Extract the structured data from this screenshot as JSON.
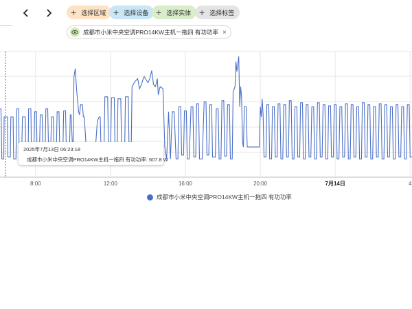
{
  "toolbar": {
    "prev_icon": "chevron-left-icon",
    "next_icon": "chevron-right-icon",
    "chips": [
      {
        "label": "选择区域",
        "color": "#fde2c4",
        "icon": "plus-icon"
      },
      {
        "label": "选择设备",
        "color": "#c9e6f7",
        "icon": "plus-icon"
      },
      {
        "label": "选择实体",
        "color": "#d9edc9",
        "icon": "plus-icon"
      },
      {
        "label": "选择标签",
        "color": "#e4e4e4",
        "icon": "plus-icon"
      }
    ]
  },
  "entity": {
    "label": "成都市小米中央空调PRO14KW主机一拖四 有功功率",
    "icon": "eye-icon",
    "close": "×"
  },
  "tooltip": {
    "time": "2025年7月13日 06:23:18",
    "series": "成都市小米中央空调PRO14KW主机一拖四 有功功率",
    "value": "607.8 W"
  },
  "chart_data": {
    "type": "line",
    "title": "",
    "xlabel": "",
    "ylabel": "",
    "x_ticks": [
      {
        "label": "8:00",
        "hour": 8,
        "bold": false
      },
      {
        "label": "12:00",
        "hour": 12,
        "bold": false
      },
      {
        "label": "16:00",
        "hour": 16,
        "bold": false
      },
      {
        "label": "20:00",
        "hour": 20,
        "bold": false
      },
      {
        "label": "7月14日",
        "hour": 24,
        "bold": true
      },
      {
        "label": "4",
        "hour": 28,
        "bold": false
      }
    ],
    "x_range_hours": [
      6.1,
      28.1
    ],
    "y_range": [
      0,
      1250
    ],
    "cursor_hour": 6.39,
    "line_color": "#4a6fc7",
    "series": [
      {
        "name": "成都市小米中央空调PRO14KW主机一拖四 有功功率",
        "color": "#4a6fc7",
        "points": [
          [
            6.1,
            680
          ],
          [
            6.15,
            680
          ],
          [
            6.2,
            180
          ],
          [
            6.3,
            180
          ],
          [
            6.32,
            600
          ],
          [
            6.5,
            600
          ],
          [
            6.52,
            200
          ],
          [
            6.65,
            200
          ],
          [
            6.68,
            600
          ],
          [
            6.8,
            600
          ],
          [
            6.83,
            180
          ],
          [
            6.95,
            180
          ],
          [
            7.0,
            680
          ],
          [
            7.1,
            680
          ],
          [
            7.12,
            200
          ],
          [
            7.25,
            200
          ],
          [
            7.3,
            600
          ],
          [
            7.45,
            600
          ],
          [
            7.48,
            180
          ],
          [
            7.6,
            180
          ],
          [
            7.63,
            680
          ],
          [
            7.75,
            680
          ],
          [
            7.78,
            200
          ],
          [
            7.9,
            200
          ],
          [
            7.95,
            650
          ],
          [
            8.05,
            650
          ],
          [
            8.08,
            190
          ],
          [
            8.2,
            190
          ],
          [
            8.25,
            620
          ],
          [
            8.35,
            620
          ],
          [
            8.4,
            190
          ],
          [
            8.5,
            190
          ],
          [
            8.55,
            680
          ],
          [
            8.65,
            680
          ],
          [
            8.7,
            200
          ],
          [
            8.8,
            200
          ],
          [
            8.85,
            600
          ],
          [
            8.95,
            600
          ],
          [
            9.0,
            180
          ],
          [
            9.1,
            180
          ],
          [
            9.15,
            650
          ],
          [
            9.25,
            650
          ],
          [
            9.3,
            190
          ],
          [
            9.45,
            190
          ],
          [
            9.5,
            660
          ],
          [
            9.6,
            660
          ],
          [
            9.65,
            180
          ],
          [
            9.8,
            180
          ],
          [
            9.85,
            620
          ],
          [
            9.9,
            620
          ],
          [
            10.0,
            160
          ],
          [
            10.05,
            1000
          ],
          [
            10.12,
            1080
          ],
          [
            10.2,
            850
          ],
          [
            10.3,
            650
          ],
          [
            10.35,
            620
          ],
          [
            10.4,
            720
          ],
          [
            10.5,
            720
          ],
          [
            10.55,
            600
          ],
          [
            10.6,
            600
          ],
          [
            10.7,
            300
          ],
          [
            11.2,
            300
          ],
          [
            11.3,
            560
          ],
          [
            11.4,
            600
          ],
          [
            11.45,
            600
          ],
          [
            11.5,
            250
          ],
          [
            11.65,
            250
          ],
          [
            11.7,
            800
          ],
          [
            11.85,
            800
          ],
          [
            11.9,
            180
          ],
          [
            12.0,
            180
          ],
          [
            12.05,
            790
          ],
          [
            12.2,
            790
          ],
          [
            12.25,
            220
          ],
          [
            12.35,
            220
          ],
          [
            12.4,
            780
          ],
          [
            12.55,
            780
          ],
          [
            12.6,
            200
          ],
          [
            12.75,
            200
          ],
          [
            12.8,
            800
          ],
          [
            12.95,
            800
          ],
          [
            13.0,
            180
          ],
          [
            13.1,
            180
          ],
          [
            13.15,
            900
          ],
          [
            13.3,
            950
          ],
          [
            13.45,
            980
          ],
          [
            13.55,
            880
          ],
          [
            13.65,
            920
          ],
          [
            13.75,
            980
          ],
          [
            13.8,
            1000
          ],
          [
            13.9,
            970
          ],
          [
            14.0,
            940
          ],
          [
            14.1,
            980
          ],
          [
            14.2,
            1060
          ],
          [
            14.3,
            920
          ],
          [
            14.4,
            900
          ],
          [
            14.5,
            980
          ],
          [
            14.55,
            820
          ],
          [
            14.65,
            900
          ],
          [
            14.8,
            880
          ],
          [
            14.9,
            300
          ],
          [
            15.0,
            180
          ],
          [
            15.1,
            650
          ],
          [
            15.2,
            180
          ],
          [
            15.3,
            650
          ],
          [
            15.4,
            650
          ],
          [
            15.5,
            180
          ],
          [
            15.6,
            180
          ],
          [
            15.65,
            700
          ],
          [
            15.75,
            700
          ],
          [
            15.8,
            220
          ],
          [
            15.9,
            220
          ],
          [
            15.95,
            660
          ],
          [
            16.05,
            660
          ],
          [
            16.1,
            180
          ],
          [
            16.2,
            180
          ],
          [
            16.3,
            700
          ],
          [
            16.4,
            700
          ],
          [
            16.45,
            200
          ],
          [
            16.55,
            200
          ],
          [
            16.6,
            730
          ],
          [
            16.7,
            730
          ],
          [
            16.75,
            180
          ],
          [
            16.9,
            180
          ],
          [
            17.0,
            750
          ],
          [
            17.1,
            750
          ],
          [
            17.15,
            220
          ],
          [
            17.25,
            220
          ],
          [
            17.3,
            720
          ],
          [
            17.4,
            720
          ],
          [
            17.45,
            200
          ],
          [
            17.6,
            200
          ],
          [
            17.65,
            680
          ],
          [
            17.75,
            680
          ],
          [
            17.8,
            180
          ],
          [
            17.9,
            180
          ],
          [
            17.95,
            760
          ],
          [
            18.05,
            760
          ],
          [
            18.1,
            210
          ],
          [
            18.2,
            210
          ],
          [
            18.25,
            720
          ],
          [
            18.35,
            720
          ],
          [
            18.4,
            180
          ],
          [
            18.5,
            180
          ],
          [
            18.55,
            850
          ],
          [
            18.65,
            900
          ],
          [
            18.7,
            1150
          ],
          [
            18.75,
            1050
          ],
          [
            18.85,
            1200
          ],
          [
            18.9,
            700
          ],
          [
            18.95,
            900
          ],
          [
            19.0,
            800
          ],
          [
            19.05,
            350
          ],
          [
            19.1,
            300
          ],
          [
            19.15,
            700
          ],
          [
            19.25,
            700
          ],
          [
            19.3,
            300
          ],
          [
            19.95,
            300
          ],
          [
            20.0,
            700
          ],
          [
            20.05,
            600
          ],
          [
            20.1,
            780
          ],
          [
            20.15,
            620
          ],
          [
            20.2,
            200
          ],
          [
            20.3,
            200
          ],
          [
            20.35,
            720
          ],
          [
            20.45,
            720
          ],
          [
            20.5,
            180
          ],
          [
            20.6,
            180
          ],
          [
            20.65,
            700
          ],
          [
            20.75,
            700
          ],
          [
            20.8,
            200
          ],
          [
            20.9,
            200
          ],
          [
            20.95,
            730
          ],
          [
            21.05,
            730
          ],
          [
            21.1,
            180
          ],
          [
            21.2,
            180
          ],
          [
            21.25,
            720
          ],
          [
            21.35,
            720
          ],
          [
            21.4,
            200
          ],
          [
            21.5,
            200
          ],
          [
            21.55,
            760
          ],
          [
            21.65,
            760
          ],
          [
            21.7,
            180
          ],
          [
            21.8,
            180
          ],
          [
            21.85,
            700
          ],
          [
            21.95,
            700
          ],
          [
            22.0,
            200
          ],
          [
            22.1,
            200
          ],
          [
            22.15,
            740
          ],
          [
            22.25,
            740
          ],
          [
            22.3,
            180
          ],
          [
            22.4,
            180
          ],
          [
            22.45,
            720
          ],
          [
            22.55,
            720
          ],
          [
            22.6,
            200
          ],
          [
            22.7,
            200
          ],
          [
            22.75,
            700
          ],
          [
            22.85,
            700
          ],
          [
            22.9,
            180
          ],
          [
            23.0,
            180
          ],
          [
            23.05,
            740
          ],
          [
            23.15,
            740
          ],
          [
            23.2,
            200
          ],
          [
            23.3,
            200
          ],
          [
            23.35,
            720
          ],
          [
            23.45,
            720
          ],
          [
            23.5,
            180
          ],
          [
            23.6,
            180
          ],
          [
            23.65,
            710
          ],
          [
            23.75,
            710
          ],
          [
            23.8,
            200
          ],
          [
            23.9,
            200
          ],
          [
            23.95,
            720
          ],
          [
            24.05,
            720
          ],
          [
            24.1,
            180
          ],
          [
            24.2,
            180
          ],
          [
            24.25,
            700
          ],
          [
            24.35,
            700
          ],
          [
            24.4,
            200
          ],
          [
            24.5,
            200
          ],
          [
            24.55,
            730
          ],
          [
            24.65,
            730
          ],
          [
            24.7,
            180
          ],
          [
            24.8,
            180
          ],
          [
            24.85,
            720
          ],
          [
            24.95,
            720
          ],
          [
            25.0,
            200
          ],
          [
            25.1,
            200
          ],
          [
            25.15,
            700
          ],
          [
            25.25,
            700
          ],
          [
            25.3,
            180
          ],
          [
            25.4,
            180
          ],
          [
            25.45,
            740
          ],
          [
            25.55,
            740
          ],
          [
            25.6,
            200
          ],
          [
            25.7,
            200
          ],
          [
            25.75,
            720
          ],
          [
            25.85,
            720
          ],
          [
            25.9,
            180
          ],
          [
            26.0,
            180
          ],
          [
            26.05,
            700
          ],
          [
            26.15,
            700
          ],
          [
            26.2,
            200
          ],
          [
            26.3,
            200
          ],
          [
            26.35,
            730
          ],
          [
            26.45,
            730
          ],
          [
            26.5,
            180
          ],
          [
            26.6,
            180
          ],
          [
            26.65,
            720
          ],
          [
            26.75,
            720
          ],
          [
            26.8,
            200
          ],
          [
            26.9,
            200
          ],
          [
            26.95,
            700
          ],
          [
            27.05,
            700
          ],
          [
            27.1,
            180
          ],
          [
            27.2,
            180
          ],
          [
            27.25,
            720
          ],
          [
            27.35,
            720
          ],
          [
            27.4,
            200
          ],
          [
            27.5,
            200
          ],
          [
            27.55,
            700
          ],
          [
            27.65,
            700
          ],
          [
            27.7,
            180
          ],
          [
            27.8,
            180
          ],
          [
            27.85,
            720
          ],
          [
            27.95,
            720
          ],
          [
            28.0,
            200
          ],
          [
            28.1,
            200
          ]
        ]
      }
    ],
    "grid": true,
    "legend_position": "bottom-center"
  }
}
